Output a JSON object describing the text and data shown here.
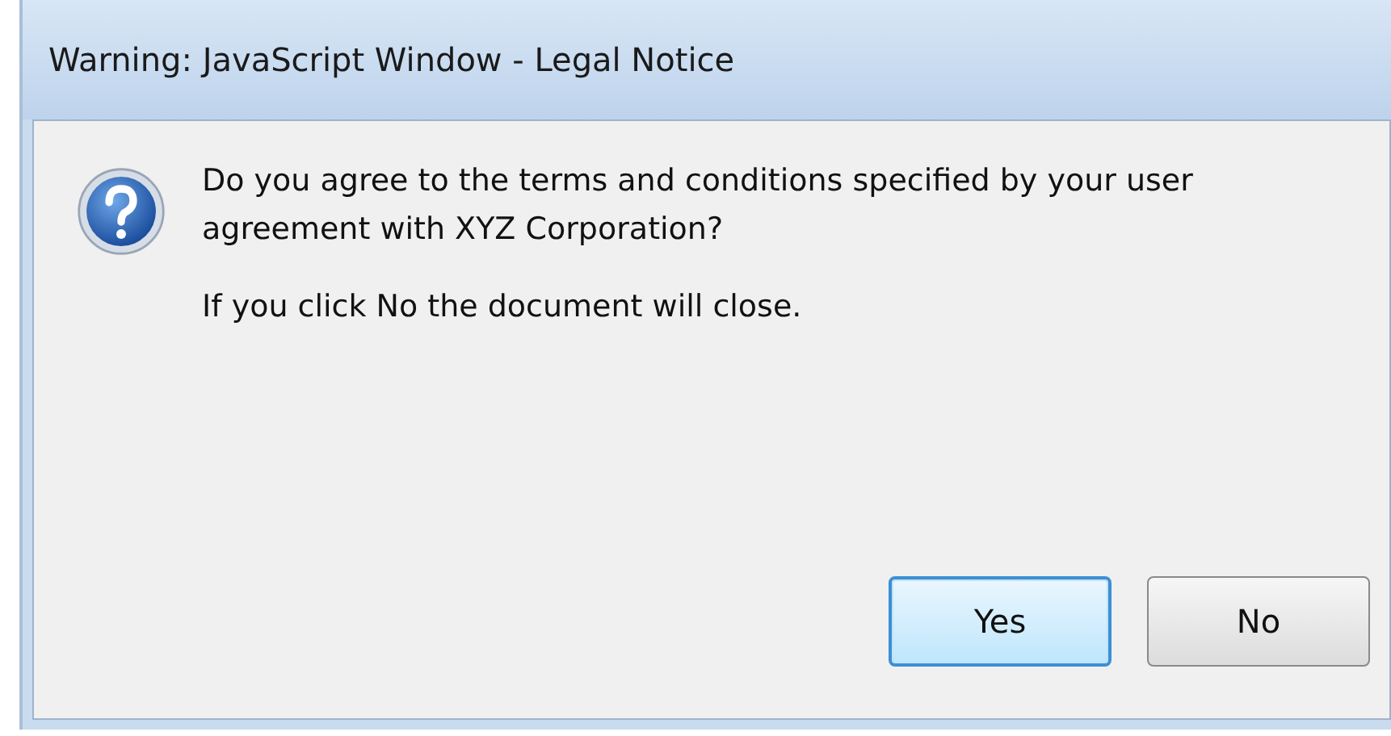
{
  "window": {
    "title": "Warning: JavaScript Window - Legal Notice"
  },
  "message": "Do you agree to the terms and conditions specified by your user agreement with XYZ Corporation?",
  "note": "If you click No the document will close.",
  "buttons": [
    {
      "label": "Yes",
      "focused": true
    },
    {
      "label": "No",
      "focused": false
    }
  ]
}
